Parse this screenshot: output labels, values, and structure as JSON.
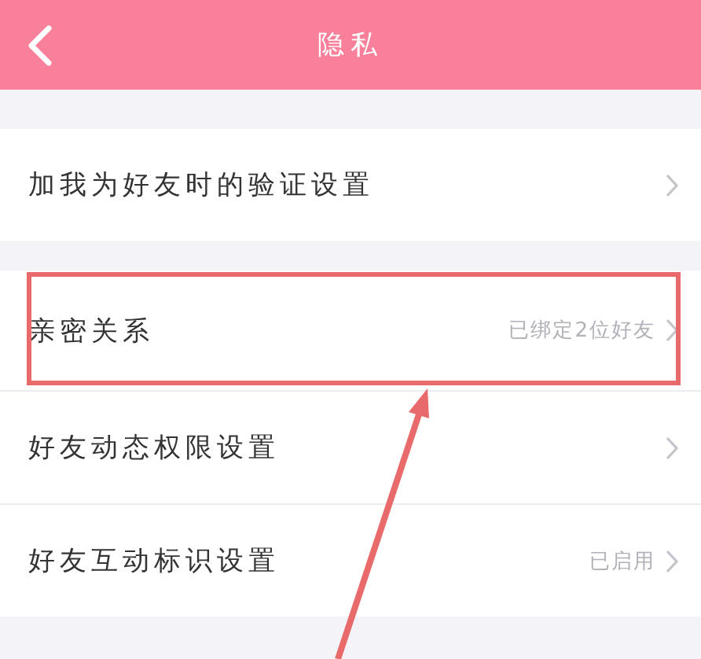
{
  "header": {
    "title": "隐私"
  },
  "groups": [
    {
      "items": [
        {
          "label": "加我为好友时的验证设置",
          "highlighted": false
        }
      ]
    },
    {
      "items": [
        {
          "label": "亲密关系",
          "value": "已绑定2位好友",
          "highlighted": true
        },
        {
          "label": "好友动态权限设置",
          "highlighted": false
        },
        {
          "label": "好友互动标识设置",
          "value": "已启用",
          "highlighted": false
        }
      ]
    }
  ]
}
